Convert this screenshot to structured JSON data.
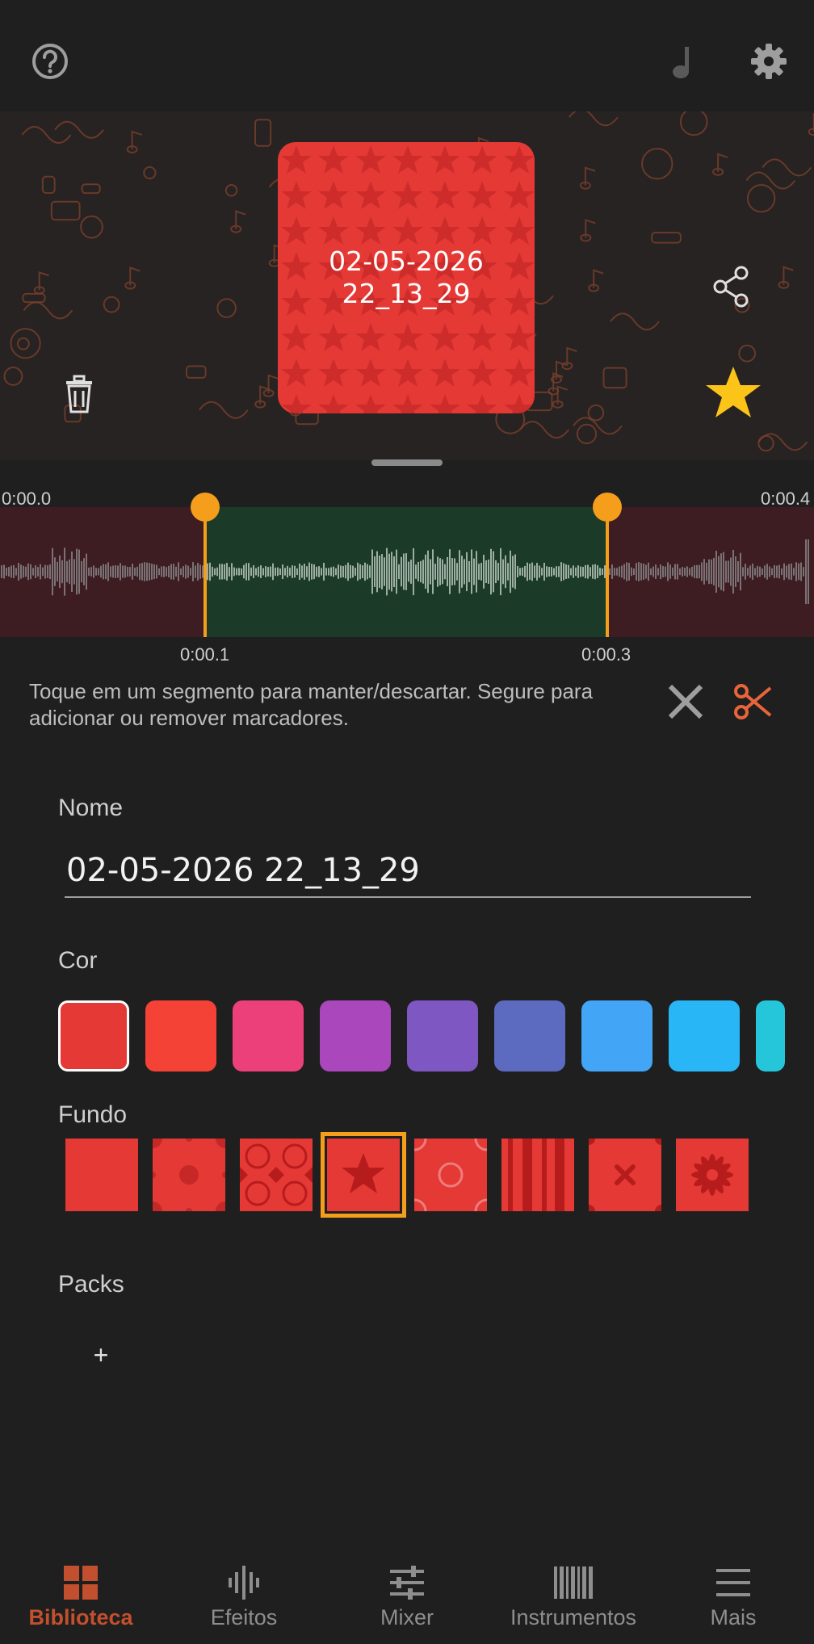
{
  "topbar": {
    "help_icon": "help-circle-icon",
    "music_icon": "music-note-icon",
    "settings_icon": "gear-icon"
  },
  "sound": {
    "name_line1": "02-05-2026",
    "name_line2": "22_13_29",
    "color": "#e53935",
    "favorite": true
  },
  "waveform": {
    "start_time": "0:00.0",
    "end_time": "0:00.4",
    "marker_left_time": "0:00.1",
    "marker_right_time": "0:00.3",
    "kept_color": "#1b3a27",
    "discarded_color": "#3d1c22",
    "marker_color": "#f59e1b"
  },
  "hint": "Toque em um segmento para manter/descartar. Segure para adicionar ou remover marcadores.",
  "form": {
    "name_label": "Nome",
    "name_value": "02-05-2026 22_13_29",
    "color_label": "Cor",
    "colors": [
      "#e53935",
      "#f44336",
      "#ec407a",
      "#ab47bc",
      "#7e57c2",
      "#5c6bc0",
      "#42a5f5",
      "#29b6f6",
      "#26c6da"
    ],
    "selected_color_index": 0,
    "background_label": "Fundo",
    "selected_background_index": 3,
    "packs_label": "Packs",
    "pack_add": "+"
  },
  "nav": [
    {
      "label": "Biblioteca",
      "icon": "grid-icon",
      "active": true
    },
    {
      "label": "Efeitos",
      "icon": "waveform-icon",
      "active": false
    },
    {
      "label": "Mixer",
      "icon": "sliders-icon",
      "active": false
    },
    {
      "label": "Instrumentos",
      "icon": "piano-icon",
      "active": false
    },
    {
      "label": "Mais",
      "icon": "menu-icon",
      "active": false
    }
  ]
}
